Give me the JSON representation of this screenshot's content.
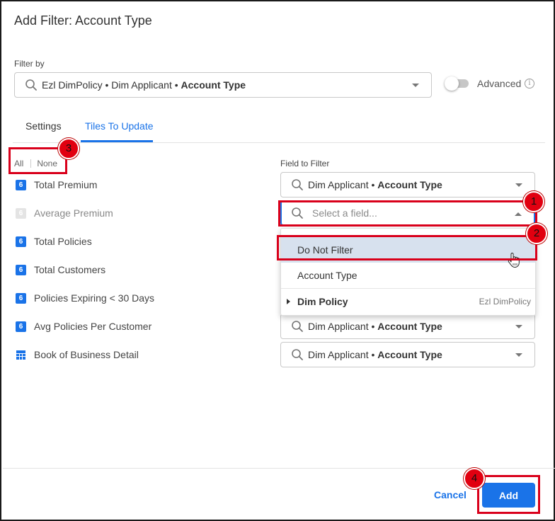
{
  "dialog": {
    "title": "Add Filter: Account Type"
  },
  "filter_by": {
    "label": "Filter by",
    "value_prefix": "Ezl DimPolicy • Dim Applicant • ",
    "value_bold": "Account Type"
  },
  "advanced": {
    "label": "Advanced",
    "enabled": false,
    "info_icon": "i"
  },
  "tabs": [
    {
      "label": "Settings",
      "active": false
    },
    {
      "label": "Tiles To Update",
      "active": true
    }
  ],
  "selection": {
    "all_label": "All",
    "none_label": "None"
  },
  "field_to_filter_label": "Field to Filter",
  "tiles": [
    {
      "label": "Total Premium",
      "icon": "6",
      "icon_type": "number",
      "enabled": true
    },
    {
      "label": "Average Premium",
      "icon": "6",
      "icon_type": "number",
      "enabled": false
    },
    {
      "label": "Total Policies",
      "icon": "6",
      "icon_type": "number",
      "enabled": true
    },
    {
      "label": "Total Customers",
      "icon": "6",
      "icon_type": "number",
      "enabled": true
    },
    {
      "label": "Policies Expiring < 30 Days",
      "icon": "6",
      "icon_type": "number",
      "enabled": true
    },
    {
      "label": "Avg Policies Per Customer",
      "icon": "6",
      "icon_type": "number",
      "enabled": true
    },
    {
      "label": "Book of Business Detail",
      "icon": "",
      "icon_type": "table",
      "enabled": true
    }
  ],
  "field_selects": {
    "row1": {
      "prefix": "Dim Applicant • ",
      "bold": "Account Type"
    },
    "row2": {
      "placeholder": "Select a field..."
    },
    "row6": {
      "prefix": "Dim Applicant • ",
      "bold": "Account Type"
    },
    "row7": {
      "prefix": "Dim Applicant • ",
      "bold": "Account Type"
    }
  },
  "dropdown": {
    "items": [
      {
        "label": "Do Not Filter",
        "hovered": true
      },
      {
        "label": "Account Type",
        "hovered": false
      }
    ],
    "group": {
      "label": "Dim Policy",
      "source": "Ezl DimPolicy"
    }
  },
  "footer": {
    "cancel_label": "Cancel",
    "add_label": "Add"
  },
  "callouts": [
    "1",
    "2",
    "3",
    "4"
  ],
  "colors": {
    "accent": "#1a73e8",
    "callout_red": "#d9001b",
    "hover_row": "#d7e1ee"
  }
}
